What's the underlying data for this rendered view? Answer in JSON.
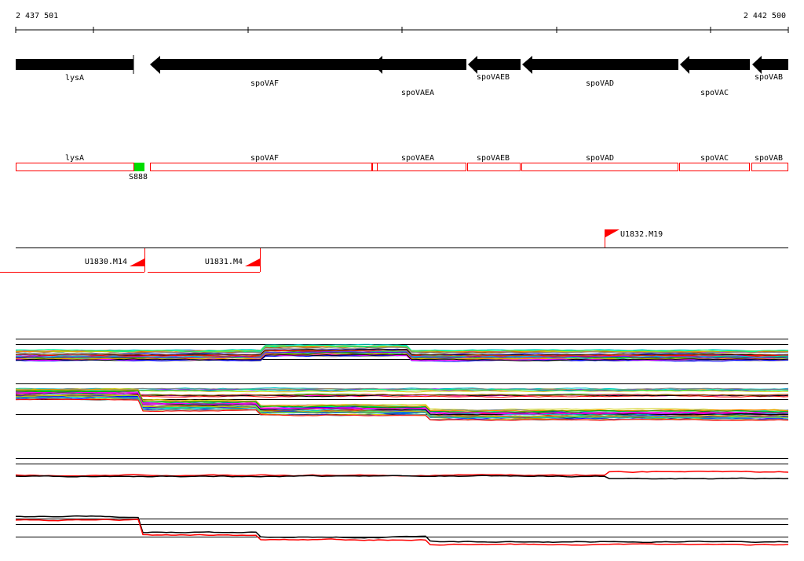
{
  "coords": {
    "start": "2 437 501",
    "end": "2 442 500"
  },
  "genes": [
    {
      "name": "lysA",
      "strand": "+"
    },
    {
      "name": "spoVAF",
      "strand": "-"
    },
    {
      "name": "spoVAEA",
      "strand": "-"
    },
    {
      "name": "spoVAEB",
      "strand": "-"
    },
    {
      "name": "spoVAD",
      "strand": "-"
    },
    {
      "name": "spoVAC",
      "strand": "-"
    },
    {
      "name": "spoVAB",
      "strand": "-"
    }
  ],
  "features": [
    {
      "name": "lysA"
    },
    {
      "name": "spoVAF"
    },
    {
      "name": "spoVAEA"
    },
    {
      "name": "spoVAEB"
    },
    {
      "name": "spoVAD"
    },
    {
      "name": "spoVAC"
    },
    {
      "name": "spoVAB"
    }
  ],
  "marker": {
    "name": "S888"
  },
  "transcription_units": [
    {
      "name": "U1830.M14",
      "strand": "-"
    },
    {
      "name": "U1831.M4",
      "strand": "-"
    },
    {
      "name": "U1832.M19",
      "strand": "+"
    }
  ],
  "colors": {
    "gene_fill": "#000000",
    "feature_outline": "#ff0000",
    "marker_fill": "#00dd00",
    "flag": "#ff0000",
    "condition_palette": [
      "#ff0000",
      "#00aa00",
      "#0000ff",
      "#ff00ff",
      "#00cccc",
      "#cccc00",
      "#ff8800",
      "#8800ff",
      "#888888",
      "#000000",
      "#aa5500",
      "#00ff88"
    ]
  }
}
